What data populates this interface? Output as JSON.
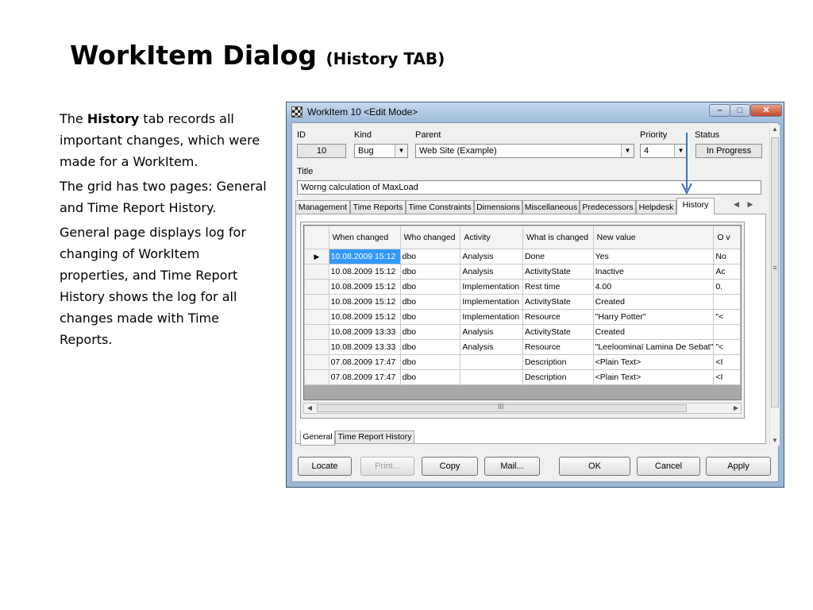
{
  "slide": {
    "title": "WorkItem Dialog",
    "title_suffix": "(History TAB)",
    "paragraphs": [
      {
        "before": "The ",
        "bold": "History",
        "after": " tab records all important changes, which were made for a WorkItem."
      },
      {
        "before": "The grid has two pages: General and Time Report History.",
        "bold": "",
        "after": ""
      },
      {
        "before": "General page displays log for changing of WorkItem properties, and Time Report History shows the log for all changes made with Time Reports.",
        "bold": "",
        "after": ""
      }
    ]
  },
  "dialog": {
    "window_title": "WorkItem 10 <Edit Mode>",
    "window_controls": {
      "minimize": "–",
      "maximize": "□",
      "close": "✕"
    },
    "fields": {
      "id": {
        "label": "ID",
        "value": "10"
      },
      "kind": {
        "label": "Kind",
        "value": "Bug"
      },
      "parent": {
        "label": "Parent",
        "value": "Web Site (Example)"
      },
      "priority": {
        "label": "Priority",
        "value": "4"
      },
      "status": {
        "label": "Status",
        "value": "In Progress"
      },
      "title": {
        "label": "Title",
        "value": "Worng calculation of MaxLoad"
      }
    },
    "tabs": [
      "Management",
      "Time Reports",
      "Time Constraints",
      "Dimensions",
      "Miscellaneous",
      "Predecessors",
      "Helpdesk",
      "History"
    ],
    "active_tab": "History",
    "grid": {
      "columns": [
        "When changed",
        "Who changed",
        "Activity",
        "What is changed",
        "New value",
        "O v"
      ],
      "rows": [
        [
          "10.08.2009 15:12",
          "dbo",
          "Analysis",
          "Done",
          "Yes",
          "No"
        ],
        [
          "10.08.2009 15:12",
          "dbo",
          "Analysis",
          "ActivityState",
          "Inactive",
          "Ac"
        ],
        [
          "10.08.2009 15:12",
          "dbo",
          "Implementation",
          "Rest time",
          "4.00",
          "0."
        ],
        [
          "10.08.2009 15:12",
          "dbo",
          "Implementation",
          "ActivityState",
          "Created",
          ""
        ],
        [
          "10.08.2009 15:12",
          "dbo",
          "Implementation",
          "Resource",
          "\"Harry Potter\"",
          "\"<"
        ],
        [
          "10.08.2009 13:33",
          "dbo",
          "Analysis",
          "ActivityState",
          "Created",
          ""
        ],
        [
          "10.08.2009 13:33",
          "dbo",
          "Analysis",
          "Resource",
          "\"Leeloominaï Lamina De Sebat\"",
          "\"<"
        ],
        [
          "07.08.2009 17:47",
          "dbo",
          "",
          "Description",
          "<Plain Text>",
          "<I"
        ],
        [
          "07.08.2009 17:47",
          "dbo",
          "",
          "Description",
          "<Plain Text>",
          "<I"
        ]
      ],
      "current_row_marker": "▶",
      "scroll_grip": "III"
    },
    "subtabs": [
      "General",
      "Time Report History"
    ],
    "active_subtab": "General",
    "buttons": {
      "locate": "Locate",
      "print": "Print...",
      "copy": "Copy",
      "mail": "Mail...",
      "ok": "OK",
      "cancel": "Cancel",
      "apply": "Apply"
    },
    "colors": {
      "selection": "#3399ff",
      "annotation_arrow": "#3a6fc4"
    }
  }
}
